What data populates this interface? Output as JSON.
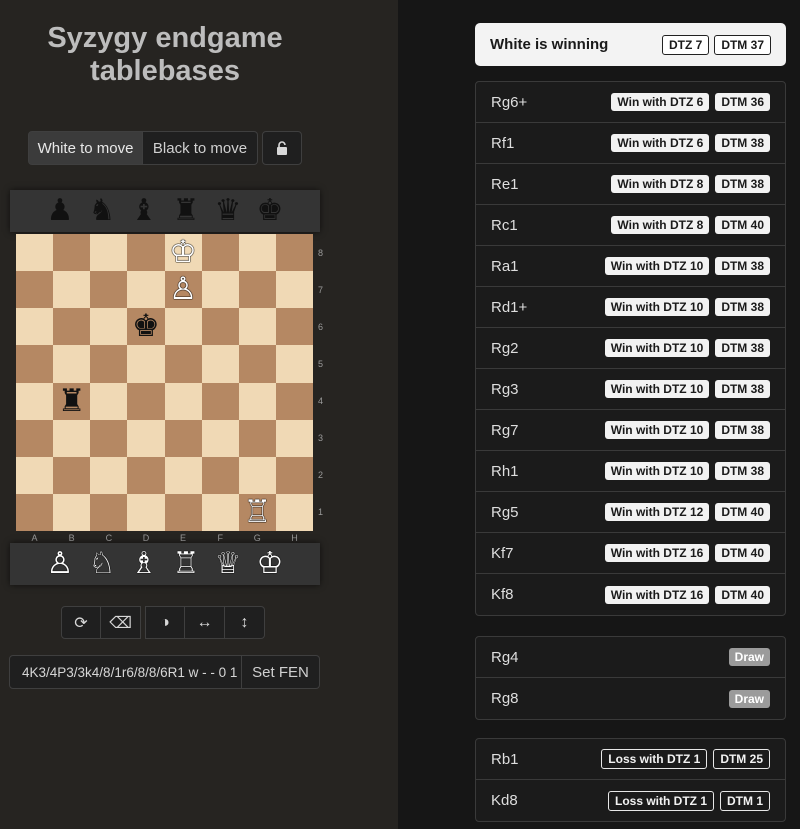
{
  "title": "Syzygy endgame tablebases",
  "to_move": {
    "white": "White to move",
    "black": "Black to move",
    "active": "white"
  },
  "lock_icon": "unlock-icon",
  "tray_black": [
    "♟",
    "♞",
    "♝",
    "♜",
    "♛",
    "♚"
  ],
  "tray_white": [
    "♙",
    "♘",
    "♗",
    "♖",
    "♕",
    "♔"
  ],
  "board": [
    [
      "",
      "",
      "",
      "",
      "K",
      "",
      "",
      ""
    ],
    [
      "",
      "",
      "",
      "",
      "P",
      "",
      "",
      ""
    ],
    [
      "",
      "",
      "",
      "k",
      "",
      "",
      "",
      ""
    ],
    [
      "",
      "",
      "",
      "",
      "",
      "",
      "",
      ""
    ],
    [
      "",
      "r",
      "",
      "",
      "",
      "",
      "",
      ""
    ],
    [
      "",
      "",
      "",
      "",
      "",
      "",
      "",
      ""
    ],
    [
      "",
      "",
      "",
      "",
      "",
      "",
      "",
      ""
    ],
    [
      "",
      "",
      "",
      "",
      "",
      "",
      "R",
      ""
    ]
  ],
  "ranks": [
    "8",
    "7",
    "6",
    "5",
    "4",
    "3",
    "2",
    "1"
  ],
  "files": [
    "A",
    "B",
    "C",
    "D",
    "E",
    "F",
    "G",
    "H"
  ],
  "tools": [
    {
      "name": "flip-board-icon",
      "glyph": "⟳"
    },
    {
      "name": "eraser-icon",
      "glyph": "⌫"
    },
    {
      "name": "contrast-icon",
      "glyph": "◑"
    },
    {
      "name": "mirror-horizontal-icon",
      "glyph": "↔"
    },
    {
      "name": "mirror-vertical-icon",
      "glyph": "↕"
    }
  ],
  "fen": "4K3/4P3/3k4/8/1r6/8/8/6R1 w - - 0 1",
  "set_fen": "Set FEN",
  "status": {
    "text": "White is winning",
    "dtz": "DTZ 7",
    "dtm": "DTM 37"
  },
  "winning": [
    {
      "move": "Rg6+",
      "dtz": "Win with DTZ 6",
      "dtm": "DTM 36"
    },
    {
      "move": "Rf1",
      "dtz": "Win with DTZ 6",
      "dtm": "DTM 38"
    },
    {
      "move": "Re1",
      "dtz": "Win with DTZ 8",
      "dtm": "DTM 38"
    },
    {
      "move": "Rc1",
      "dtz": "Win with DTZ 8",
      "dtm": "DTM 40"
    },
    {
      "move": "Ra1",
      "dtz": "Win with DTZ 10",
      "dtm": "DTM 38"
    },
    {
      "move": "Rd1+",
      "dtz": "Win with DTZ 10",
      "dtm": "DTM 38"
    },
    {
      "move": "Rg2",
      "dtz": "Win with DTZ 10",
      "dtm": "DTM 38"
    },
    {
      "move": "Rg3",
      "dtz": "Win with DTZ 10",
      "dtm": "DTM 38"
    },
    {
      "move": "Rg7",
      "dtz": "Win with DTZ 10",
      "dtm": "DTM 38"
    },
    {
      "move": "Rh1",
      "dtz": "Win with DTZ 10",
      "dtm": "DTM 38"
    },
    {
      "move": "Rg5",
      "dtz": "Win with DTZ 12",
      "dtm": "DTM 40"
    },
    {
      "move": "Kf7",
      "dtz": "Win with DTZ 16",
      "dtm": "DTM 40"
    },
    {
      "move": "Kf8",
      "dtz": "Win with DTZ 16",
      "dtm": "DTM 40"
    }
  ],
  "drawing": [
    {
      "move": "Rg4",
      "label": "Draw"
    },
    {
      "move": "Rg8",
      "label": "Draw"
    }
  ],
  "losing": [
    {
      "move": "Rb1",
      "dtz": "Loss with DTZ 1",
      "dtm": "DTM 25"
    },
    {
      "move": "Kd8",
      "dtz": "Loss with DTZ 1",
      "dtm": "DTM 1"
    }
  ]
}
